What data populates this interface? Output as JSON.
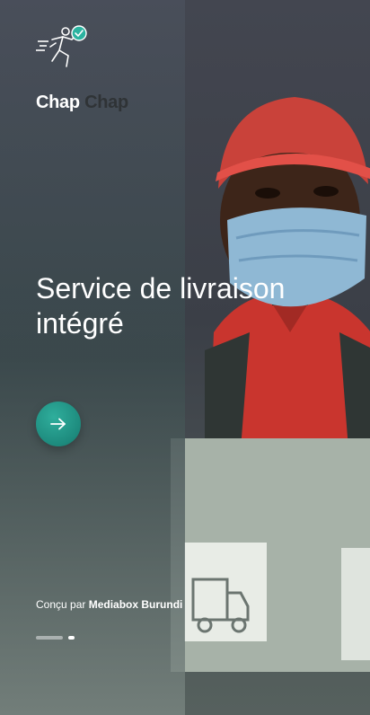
{
  "brand": {
    "word1": "Chap",
    "word2": "Chap"
  },
  "onboarding": {
    "headline_line1": "Service de livraison",
    "headline_line2": "intégré",
    "next_icon": "arrow-right-icon",
    "accent_color": "#1d8a7d"
  },
  "footer": {
    "credit_prefix": "Conçu par",
    "credit_name": "Mediabox Burundi"
  },
  "pager": {
    "total": 2,
    "active_index": 1
  }
}
